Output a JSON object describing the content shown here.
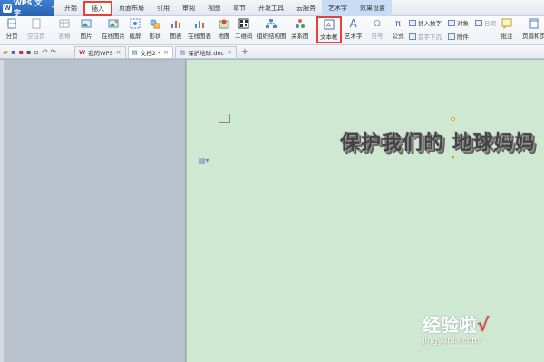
{
  "app": {
    "logo_text": "WPS 文字",
    "logo_mark": "W",
    "logo_drop": "▾"
  },
  "menu": {
    "tabs": [
      "开始",
      "插入",
      "页面布局",
      "引用",
      "审阅",
      "视图",
      "章节",
      "开发工具",
      "云服务",
      "艺术字",
      "效果设置"
    ],
    "active": "插入"
  },
  "ribbon": {
    "page_break": "分页",
    "blank_page": "空白页",
    "table": "表格",
    "picture": "图片",
    "online_picture": "在线图片",
    "screenshot": "截屏",
    "shape": "形状",
    "chart": "图表",
    "online_chart": "在线图表",
    "map": "地图",
    "qrcode": "二维码",
    "org_chart": "组织结构图",
    "relation": "关系图",
    "textbox": "文本框",
    "wordart": "艺术字",
    "symbol": "符号",
    "formula": "公式",
    "insert_number": "插入数字",
    "object": "对象",
    "date": "日期",
    "first_letter": "首字下沉",
    "attachment": "附件",
    "comment": "批注",
    "header_footer": "页眉和页"
  },
  "doctabs": {
    "tabs": [
      {
        "label": "我的WPS",
        "close": "×"
      },
      {
        "label": "文档2 *",
        "close": "×"
      },
      {
        "label": "保护地球.doc",
        "close": "×"
      }
    ],
    "plus": "+"
  },
  "document": {
    "wordart_text": "保护我们的 地球妈妈"
  },
  "watermark": {
    "line1": "经验啦",
    "check": "√",
    "line2": "jingyanla.com"
  }
}
